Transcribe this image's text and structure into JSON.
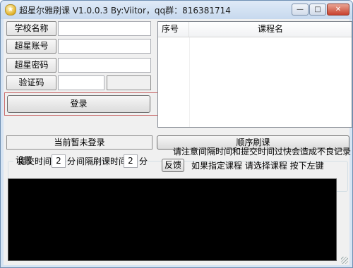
{
  "window": {
    "title": "超星尔雅刷课 V1.0.0.3 By:Viitor，qq群：816381714",
    "app_icon": "star-icon"
  },
  "titlebar_buttons": {
    "minimize": "—",
    "maximize": "□",
    "close": "✕"
  },
  "form": {
    "school_label": "学校名称",
    "school_value": "",
    "account_label": "超星账号",
    "account_value": "",
    "password_label": "超星密码",
    "password_value": "",
    "captcha_label": "验证码",
    "captcha_value": ""
  },
  "login_button": "登录",
  "course_list": {
    "col_index": "序号",
    "col_name": "课程名",
    "rows": []
  },
  "status_text": "当前暂未登录",
  "sequential_button": "顺序刷课",
  "settings": {
    "group_title": "设置",
    "submit_time_label": "提交时间",
    "submit_time_value": "2",
    "submit_unit": "分",
    "interval_label": "间隔刷课时间",
    "interval_value": "2",
    "interval_unit": "分",
    "warning": "请注意间隔时间和提交时间过快会造成不良记录",
    "feedback_button": "反馈",
    "hint": "如果指定课程 请选择课程 按下左键"
  }
}
